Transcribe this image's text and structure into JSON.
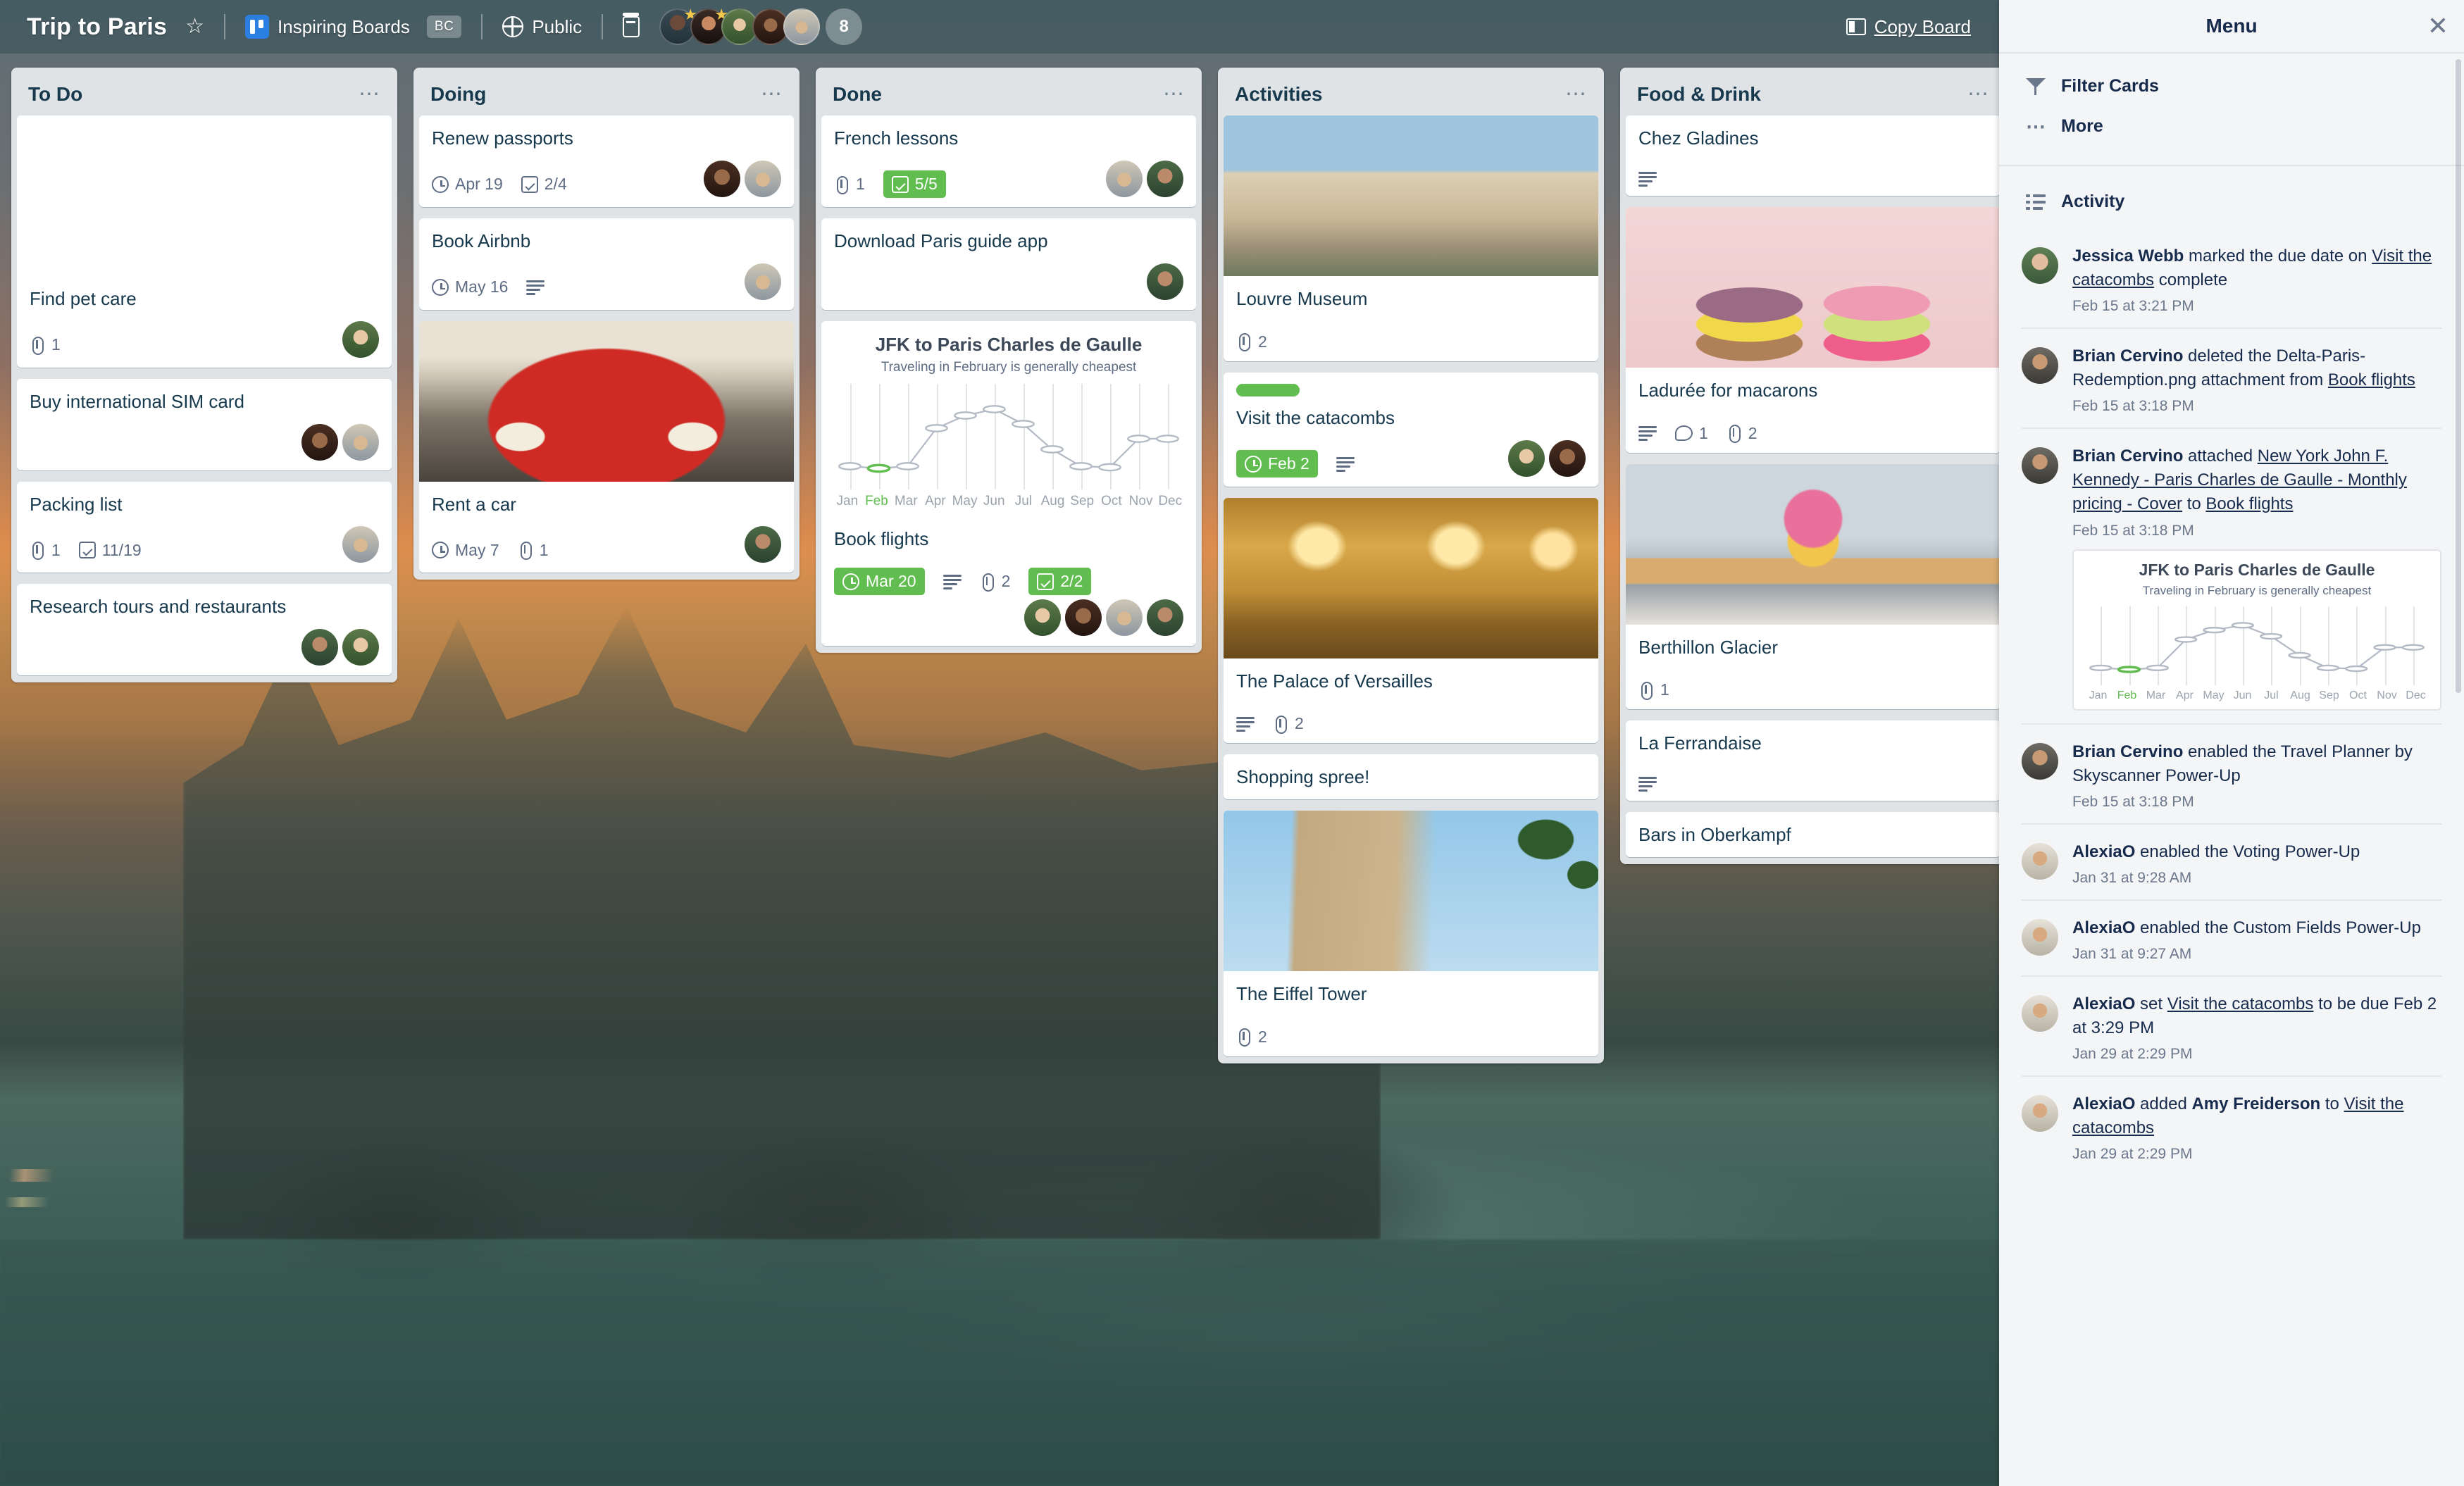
{
  "header": {
    "board_title": "Trip to Paris",
    "star_icon": "star-icon",
    "team_name": "Inspiring Boards",
    "team_badge": "BC",
    "visibility": "Public",
    "calendar_icon": "calendar-icon",
    "member_overflow_count": "8",
    "copy_board_label": "Copy Board",
    "copy_board_icon": "board-icon"
  },
  "lists": [
    {
      "title": "To Do",
      "cards": [
        {
          "title": "Find pet care",
          "cover": "husky-dog-photo",
          "badges": [
            {
              "type": "attachment",
              "value": "1"
            }
          ],
          "members": 1
        },
        {
          "title": "Buy international SIM card",
          "badges": [],
          "members": 2
        },
        {
          "title": "Packing list",
          "badges": [
            {
              "type": "attachment",
              "value": "1"
            },
            {
              "type": "checklist",
              "value": "11/19"
            }
          ],
          "members": 1
        },
        {
          "title": "Research tours and restaurants",
          "badges": [],
          "members": 2
        }
      ]
    },
    {
      "title": "Doing",
      "cards": [
        {
          "title": "Renew passports",
          "badges": [
            {
              "type": "due",
              "value": "Apr 19"
            },
            {
              "type": "checklist",
              "value": "2/4"
            }
          ],
          "members": 2
        },
        {
          "title": "Book Airbnb",
          "badges": [
            {
              "type": "due",
              "value": "May 16"
            },
            {
              "type": "description",
              "value": ""
            }
          ],
          "members": 1
        },
        {
          "title": "Rent a car",
          "cover": "red-vw-beetle-photo",
          "badges": [
            {
              "type": "due",
              "value": "May 7"
            },
            {
              "type": "attachment",
              "value": "1"
            }
          ],
          "members": 1
        }
      ]
    },
    {
      "title": "Done",
      "cards": [
        {
          "title": "French lessons",
          "badges": [
            {
              "type": "attachment",
              "value": "1"
            },
            {
              "type": "checklist",
              "value": "5/5",
              "complete": true
            }
          ],
          "members": 2
        },
        {
          "title": "Download Paris guide app",
          "badges": [],
          "members": 1
        },
        {
          "title": "Book flights",
          "chart": true,
          "badges": [
            {
              "type": "due",
              "value": "Mar 20",
              "complete": true
            },
            {
              "type": "description",
              "value": ""
            },
            {
              "type": "attachment",
              "value": "2"
            },
            {
              "type": "checklist",
              "value": "2/2",
              "complete": true
            }
          ],
          "members": 4
        }
      ]
    },
    {
      "title": "Activities",
      "cards": [
        {
          "title": "Louvre Museum",
          "cover": "louvre-museum-photo",
          "badges": [
            {
              "type": "attachment",
              "value": "2"
            }
          ],
          "members": 0
        },
        {
          "title": "Visit the catacombs",
          "label": "#61bd4f",
          "badges": [
            {
              "type": "due",
              "value": "Feb 2",
              "complete": true
            },
            {
              "type": "description",
              "value": ""
            }
          ],
          "members": 2
        },
        {
          "title": "The Palace of Versailles",
          "cover": "versailles-hall-of-mirrors-photo",
          "badges": [
            {
              "type": "description",
              "value": ""
            },
            {
              "type": "attachment",
              "value": "2"
            }
          ],
          "members": 0
        },
        {
          "title": "Shopping spree!",
          "badges": [],
          "members": 0
        },
        {
          "title": "The Eiffel Tower",
          "cover": "eiffel-tower-photo",
          "badges": [
            {
              "type": "attachment",
              "value": "2"
            }
          ],
          "members": 0
        }
      ]
    },
    {
      "title": "Food & Drink",
      "cards": [
        {
          "title": "Chez Gladines",
          "badges": [
            {
              "type": "description",
              "value": ""
            }
          ],
          "members": 0
        },
        {
          "title": "Ladurée for macarons",
          "cover": "laduree-macarons-photo",
          "badges": [
            {
              "type": "description",
              "value": ""
            },
            {
              "type": "comment",
              "value": "1"
            },
            {
              "type": "attachment",
              "value": "2"
            }
          ],
          "members": 0
        },
        {
          "title": "Berthillon Glacier",
          "cover": "ice-cream-cone-photo",
          "badges": [
            {
              "type": "attachment",
              "value": "1"
            }
          ],
          "members": 0
        },
        {
          "title": "La Ferrandaise",
          "badges": [
            {
              "type": "description",
              "value": ""
            }
          ],
          "members": 0
        },
        {
          "title": "Bars in Oberkampf",
          "badges": [],
          "members": 0
        }
      ]
    }
  ],
  "sidebar": {
    "title": "Menu",
    "close_icon": "close-icon",
    "actions": [
      {
        "label": "Filter Cards",
        "icon": "filter-icon"
      },
      {
        "label": "More",
        "icon": "more-icon"
      }
    ],
    "activity_label": "Activity",
    "activity_icon": "activity-icon",
    "feed": [
      {
        "actor": "Jessica Webb",
        "text_before": " marked the due date on ",
        "link": "Visit the catacombs",
        "text_after": " complete",
        "time": "Feb 15 at 3:21 PM"
      },
      {
        "actor": "Brian Cervino",
        "text_before": " deleted the Delta-Paris-Redemption.png attachment from ",
        "link": "Book flights",
        "text_after": "",
        "time": "Feb 15 at 3:18 PM"
      },
      {
        "actor": "Brian Cervino",
        "text_before": " attached ",
        "link": "New York John F. Kennedy - Paris Charles de Gaulle - Monthly pricing - Cover",
        "text_mid": " to ",
        "link2": "Book flights",
        "text_after": "",
        "time": "Feb 15 at 3:18 PM",
        "has_chart": true
      },
      {
        "actor": "Brian Cervino",
        "text_before": " enabled the Travel Planner by Skyscanner Power-Up",
        "time": "Feb 15 at 3:18 PM"
      },
      {
        "actor": "AlexiaO",
        "text_before": " enabled the Voting Power-Up",
        "time": "Jan 31 at 9:28 AM"
      },
      {
        "actor": "AlexiaO",
        "text_before": " enabled the Custom Fields Power-Up",
        "time": "Jan 31 at 9:27 AM"
      },
      {
        "actor": "AlexiaO",
        "text_before": " set ",
        "link": "Visit the catacombs",
        "text_after": " to be due Feb 2 at 3:29 PM",
        "time": "Jan 29 at 2:29 PM"
      },
      {
        "actor": "AlexiaO",
        "text_before": " added ",
        "bold2": "Amy Freiderson",
        "text_mid": " to ",
        "link2": "Visit the catacombs",
        "text_after": "",
        "time": "Jan 29 at 2:29 PM"
      }
    ]
  },
  "chart_data": {
    "type": "line",
    "title": "JFK to Paris Charles de Gaulle",
    "subtitle": "Traveling in February is generally cheapest",
    "xlabel": "",
    "ylabel": "",
    "categories": [
      "Jan",
      "Feb",
      "Mar",
      "Apr",
      "May",
      "Jun",
      "Jul",
      "Aug",
      "Sep",
      "Oct",
      "Nov",
      "Dec"
    ],
    "values": [
      22,
      20,
      22,
      58,
      70,
      76,
      62,
      38,
      22,
      21,
      48,
      48
    ],
    "ylim": [
      0,
      100
    ],
    "grid": true,
    "highlight_category": "Feb",
    "highlight_color": "#61bd4f",
    "line_color": "#b3bac5",
    "legend": "none"
  },
  "colors": {
    "green": "#61bd4f",
    "list_bg": "#dfe3e6",
    "card_bg": "#ffffff",
    "text": "#17394d",
    "sidebar_bg": "#f4f5f7"
  }
}
